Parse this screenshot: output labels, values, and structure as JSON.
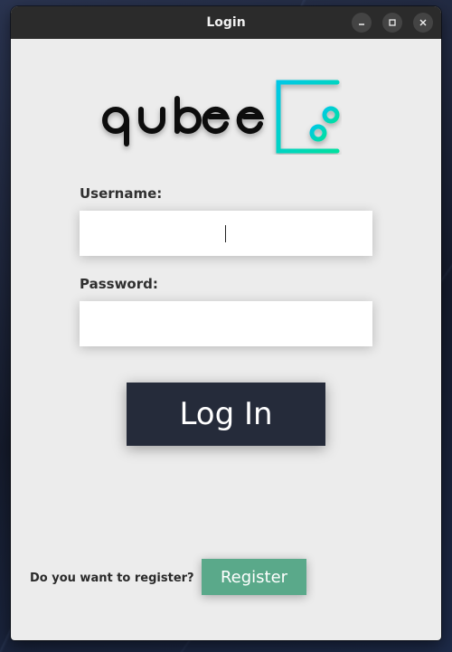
{
  "window": {
    "title": "Login",
    "controls": [
      "minimize-icon",
      "maximize-icon",
      "close-icon"
    ]
  },
  "logo": {
    "text": "qubee",
    "icon": "dice-plus-circles-icon",
    "gradient": [
      "#00c2e8",
      "#00e0a0"
    ]
  },
  "form": {
    "username_label": "Username:",
    "username_value": "",
    "password_label": "Password:",
    "password_value": "",
    "login_label": "Log In"
  },
  "register": {
    "prompt": "Do you want to register?",
    "button_label": "Register"
  },
  "colors": {
    "login_button": "#252b3a",
    "register_button": "#5aa98a",
    "window_bg": "#ececec",
    "titlebar_bg": "#2b2b2b"
  }
}
